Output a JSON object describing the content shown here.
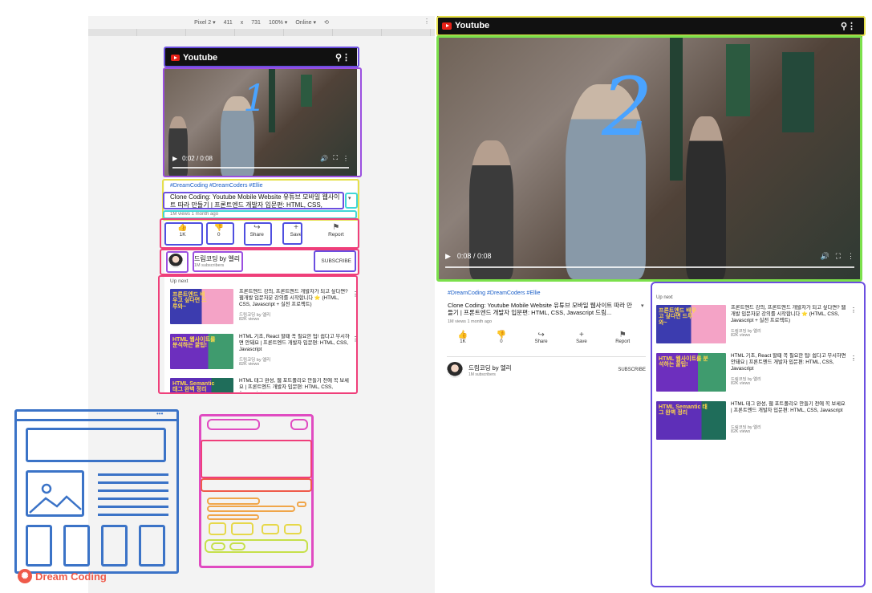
{
  "devtools": {
    "device": "Pixel 2 ▾",
    "width": "411",
    "times": "x",
    "height": "731",
    "zoom": "100% ▾",
    "network": "Online ▾",
    "rotate_icon": "rotate-icon",
    "more_icon": "more-vert-icon"
  },
  "brand": {
    "name": "Youtube",
    "color": "#e62117"
  },
  "small_player": {
    "time": "0:02 / 0:08",
    "scribble": "1"
  },
  "large_player": {
    "time": "0:08 / 0:08",
    "scribble": "2"
  },
  "video": {
    "hashtags": "#DreamCoding #DreamCoders #Ellie",
    "title_small": "Clone Coding: Youtube Mobile Website 유튜브 모바일 웹사이트 따라 만들기 | 프론트엔드 개발자 입문편: HTML, CSS,",
    "title_large": "Clone Coding: Youtube Mobile Website 유튜브 모바일 웹사이트 따라 만들기 | 프론트엔드 개발자 입문편: HTML, CSS, Javascript 드림...",
    "meta": "1M views 1 month ago"
  },
  "actions": [
    {
      "label": "1K",
      "icon": "thumbs-up-icon",
      "glyph": "👍"
    },
    {
      "label": "0",
      "icon": "thumbs-down-icon",
      "glyph": "👎"
    },
    {
      "label": "Share",
      "icon": "share-icon",
      "glyph": "↪"
    },
    {
      "label": "Save",
      "icon": "add-icon",
      "glyph": "+"
    },
    {
      "label": "Report",
      "icon": "flag-icon",
      "glyph": "⚑"
    }
  ],
  "channel": {
    "name": "드림코딩 by 엘리",
    "subs": "1M subscribers",
    "subscribe": "SUBSCRIBE"
  },
  "upnext": {
    "label": "Up next",
    "items": [
      {
        "title": "프론트엔드 강의, 프론트엔드 개발자가 되고 싶다면? 웹개발 입문자분 강의를 시작합니다 ⭐ (HTML, CSS, Javascript + 실전 프로젝트)",
        "channel": "드림코딩 by 엘리",
        "views": "82K views",
        "thumb_text": "프론트엔드 배우고 싶다면 드루와~"
      },
      {
        "title": "HTML 기초, React 할때 꼭 필요한 팁! 쉽다고 무시하면 안돼요 | 프론트엔드 개발자 입문편: HTML, CSS, Javascript",
        "channel": "드림코딩 by 엘리",
        "views": "82K views",
        "thumb_text": "HTML 웹사이트를 분석하는 꿀팁!"
      },
      {
        "title": "HTML 태그 완성, 웹 포트폴리오 만들기 전에 꼭 보세요 | 프론트엔드 개발자 입문편: HTML, CSS, Javascript",
        "channel": "드림코딩 by 엘리",
        "views": "82K views",
        "thumb_text": "HTML Semantic 태그 완벽 정리"
      }
    ]
  },
  "footer_brand": "Dream Coding",
  "colors": {
    "blue": "#3b73c7",
    "violet": "#6b4fe0",
    "green": "#7be04b",
    "pink": "#ef3f7a",
    "cyan": "#41d6d6",
    "yellow": "#e6e04a",
    "magenta": "#e04bc1"
  }
}
